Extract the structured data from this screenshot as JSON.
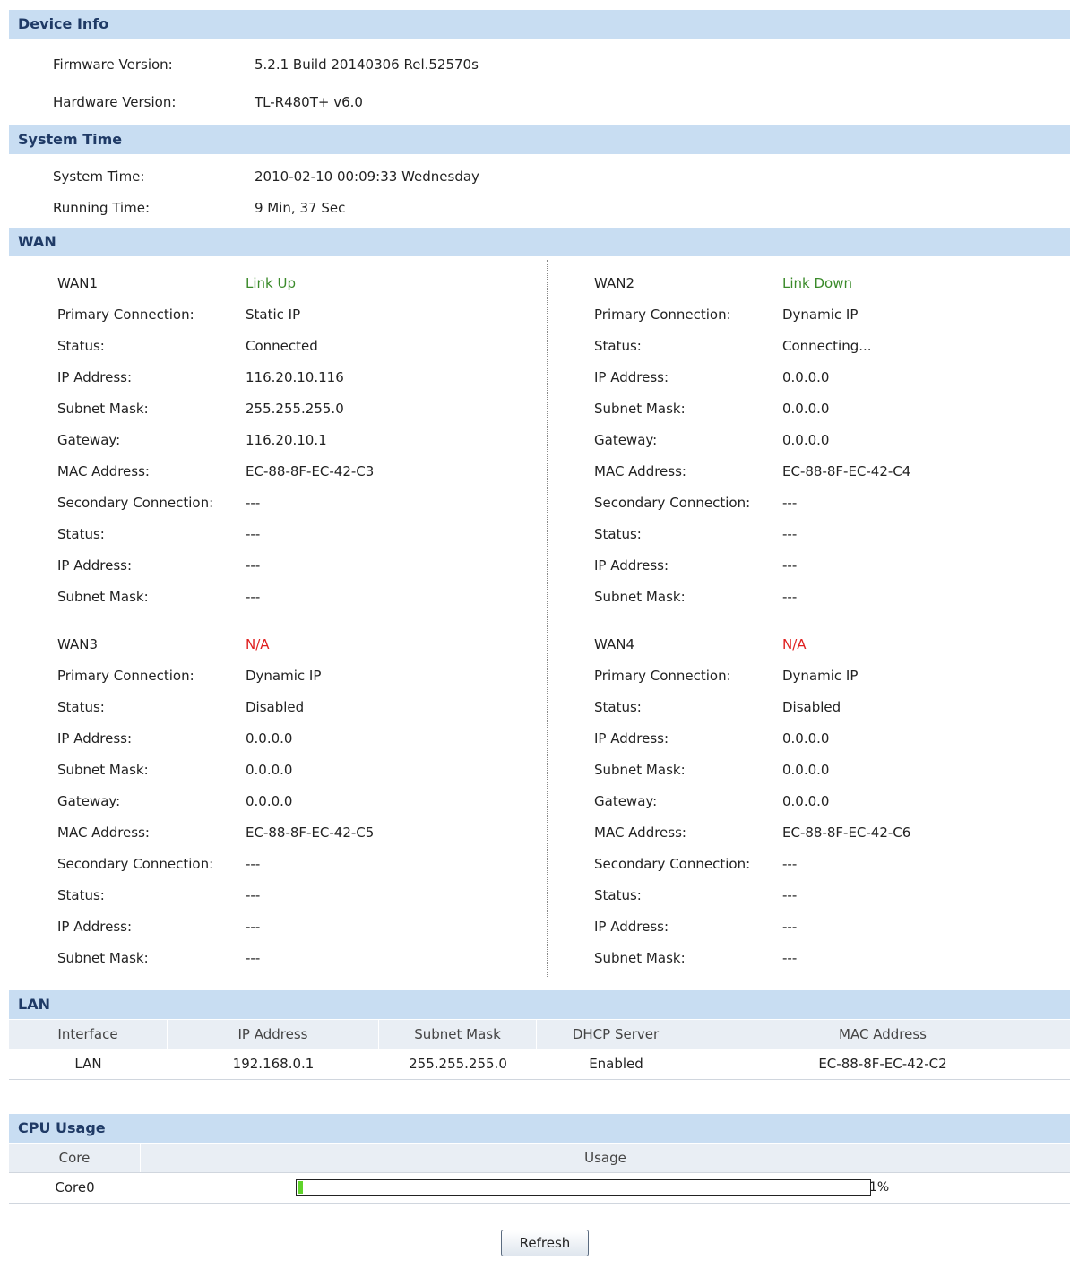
{
  "device_info": {
    "title": "Device Info",
    "firmware_label": "Firmware Version:",
    "firmware_value": "5.2.1 Build 20140306 Rel.52570s",
    "hardware_label": "Hardware Version:",
    "hardware_value": "TL-R480T+ v6.0"
  },
  "system_time": {
    "title": "System Time",
    "system_time_label": "System Time:",
    "system_time_value": "2010-02-10 00:09:33 Wednesday",
    "running_time_label": "Running Time:",
    "running_time_value": "9 Min, 37 Sec"
  },
  "wan": {
    "title": "WAN",
    "labels": {
      "primary": "Primary Connection:",
      "status": "Status:",
      "ip": "IP Address:",
      "mask": "Subnet Mask:",
      "gateway": "Gateway:",
      "mac": "MAC Address:",
      "secondary": "Secondary Connection:"
    },
    "ports": [
      {
        "name": "WAN1",
        "link": "Link Up",
        "primary": "Static IP",
        "status": "Connected",
        "ip": "116.20.10.116",
        "mask": "255.255.255.0",
        "gateway": "116.20.10.1",
        "mac": "EC-88-8F-EC-42-C3",
        "secondary": "---",
        "sec_status": "---",
        "sec_ip": "---",
        "sec_mask": "---"
      },
      {
        "name": "WAN2",
        "link": "Link Down",
        "primary": "Dynamic IP",
        "status": "Connecting...",
        "ip": "0.0.0.0",
        "mask": "0.0.0.0",
        "gateway": "0.0.0.0",
        "mac": "EC-88-8F-EC-42-C4",
        "secondary": "---",
        "sec_status": "---",
        "sec_ip": "---",
        "sec_mask": "---"
      },
      {
        "name": "WAN3",
        "link": "N/A",
        "primary": "Dynamic IP",
        "status": "Disabled",
        "ip": "0.0.0.0",
        "mask": "0.0.0.0",
        "gateway": "0.0.0.0",
        "mac": "EC-88-8F-EC-42-C5",
        "secondary": "---",
        "sec_status": "---",
        "sec_ip": "---",
        "sec_mask": "---"
      },
      {
        "name": "WAN4",
        "link": "N/A",
        "primary": "Dynamic IP",
        "status": "Disabled",
        "ip": "0.0.0.0",
        "mask": "0.0.0.0",
        "gateway": "0.0.0.0",
        "mac": "EC-88-8F-EC-42-C6",
        "secondary": "---",
        "sec_status": "---",
        "sec_ip": "---",
        "sec_mask": "---"
      }
    ]
  },
  "lan": {
    "title": "LAN",
    "columns": [
      "Interface",
      "IP Address",
      "Subnet Mask",
      "DHCP Server",
      "MAC Address"
    ],
    "rows": [
      {
        "interface": "LAN",
        "ip": "192.168.0.1",
        "mask": "255.255.255.0",
        "dhcp": "Enabled",
        "mac": "EC-88-8F-EC-42-C2"
      }
    ]
  },
  "cpu": {
    "title": "CPU Usage",
    "columns": [
      "Core",
      "Usage"
    ],
    "rows": [
      {
        "core": "Core0",
        "usage_text": "1%",
        "usage_fraction": 0.01
      }
    ]
  },
  "refresh_label": "Refresh",
  "colors": {
    "header_bg": "#c8ddf2",
    "link_up": "#3a8a2a",
    "na": "#e02020",
    "bar_fill": "#5fd32a"
  }
}
